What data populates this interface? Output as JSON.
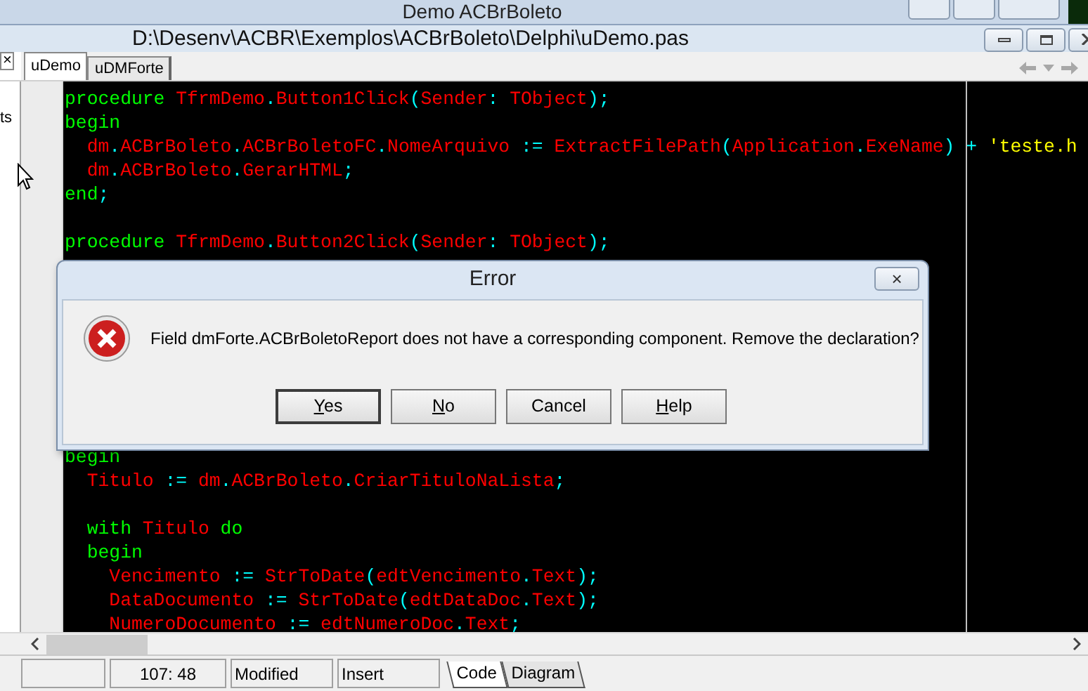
{
  "background_window": {
    "title": "Demo ACBrBoleto"
  },
  "window": {
    "title": "D:\\Desenv\\ACBR\\Exemplos\\ACBrBoleto\\Delphi\\uDemo.pas"
  },
  "side_panel": {
    "close": "×",
    "label": "ts"
  },
  "tabs": [
    {
      "label": "uDemo",
      "selected": true
    },
    {
      "label": "uDMForte",
      "selected": false
    }
  ],
  "code_top": [
    {
      "kind": "code",
      "tokens": [
        {
          "kind": "keyword",
          "text": "procedure "
        },
        {
          "kind": "ident",
          "text": "TfrmDemo"
        },
        {
          "kind": "symbol",
          "text": "."
        },
        {
          "kind": "ident",
          "text": "Button1Click"
        },
        {
          "kind": "symbol",
          "text": "("
        },
        {
          "kind": "ident",
          "text": "Sender"
        },
        {
          "kind": "symbol",
          "text": ": "
        },
        {
          "kind": "ident",
          "text": "TObject"
        },
        {
          "kind": "symbol",
          "text": ");"
        }
      ]
    },
    {
      "kind": "code",
      "tokens": [
        {
          "kind": "keyword",
          "text": "begin"
        }
      ]
    },
    {
      "kind": "code",
      "tokens": [
        {
          "kind": "ident",
          "text": "  dm"
        },
        {
          "kind": "symbol",
          "text": "."
        },
        {
          "kind": "ident",
          "text": "ACBrBoleto"
        },
        {
          "kind": "symbol",
          "text": "."
        },
        {
          "kind": "ident",
          "text": "ACBrBoletoFC"
        },
        {
          "kind": "symbol",
          "text": "."
        },
        {
          "kind": "ident",
          "text": "NomeArquivo"
        },
        {
          "kind": "symbol",
          "text": " := "
        },
        {
          "kind": "ident",
          "text": "ExtractFilePath"
        },
        {
          "kind": "symbol",
          "text": "("
        },
        {
          "kind": "ident",
          "text": "Application"
        },
        {
          "kind": "symbol",
          "text": "."
        },
        {
          "kind": "ident",
          "text": "ExeName"
        },
        {
          "kind": "symbol",
          "text": ") + "
        },
        {
          "kind": "string",
          "text": "'teste.h"
        }
      ]
    },
    {
      "kind": "code",
      "tokens": [
        {
          "kind": "ident",
          "text": "  dm"
        },
        {
          "kind": "symbol",
          "text": "."
        },
        {
          "kind": "ident",
          "text": "ACBrBoleto"
        },
        {
          "kind": "symbol",
          "text": "."
        },
        {
          "kind": "ident",
          "text": "GerarHTML"
        },
        {
          "kind": "symbol",
          "text": ";"
        }
      ]
    },
    {
      "kind": "code",
      "tokens": [
        {
          "kind": "keyword",
          "text": "end"
        },
        {
          "kind": "symbol",
          "text": ";"
        }
      ]
    },
    {
      "kind": "blank"
    },
    {
      "kind": "code",
      "tokens": [
        {
          "kind": "keyword",
          "text": "procedure "
        },
        {
          "kind": "ident",
          "text": "TfrmDemo"
        },
        {
          "kind": "symbol",
          "text": "."
        },
        {
          "kind": "ident",
          "text": "Button2Click"
        },
        {
          "kind": "symbol",
          "text": "("
        },
        {
          "kind": "ident",
          "text": "Sender"
        },
        {
          "kind": "symbol",
          "text": ": "
        },
        {
          "kind": "ident",
          "text": "TObject"
        },
        {
          "kind": "symbol",
          "text": ");"
        }
      ]
    }
  ],
  "code_bottom": [
    {
      "kind": "code",
      "tokens": [
        {
          "kind": "keyword",
          "text": "begin"
        }
      ]
    },
    {
      "kind": "code",
      "tokens": [
        {
          "kind": "ident",
          "text": "  Titulo"
        },
        {
          "kind": "symbol",
          "text": " := "
        },
        {
          "kind": "ident",
          "text": "dm"
        },
        {
          "kind": "symbol",
          "text": "."
        },
        {
          "kind": "ident",
          "text": "ACBrBoleto"
        },
        {
          "kind": "symbol",
          "text": "."
        },
        {
          "kind": "ident",
          "text": "CriarTituloNaLista"
        },
        {
          "kind": "symbol",
          "text": ";"
        }
      ]
    },
    {
      "kind": "blank"
    },
    {
      "kind": "code",
      "tokens": [
        {
          "kind": "keyword",
          "text": "  with "
        },
        {
          "kind": "ident",
          "text": "Titulo"
        },
        {
          "kind": "keyword",
          "text": " do"
        }
      ]
    },
    {
      "kind": "code",
      "tokens": [
        {
          "kind": "keyword",
          "text": "  begin"
        }
      ]
    },
    {
      "kind": "code",
      "tokens": [
        {
          "kind": "ident",
          "text": "    Vencimento"
        },
        {
          "kind": "symbol",
          "text": " := "
        },
        {
          "kind": "ident",
          "text": "StrToDate"
        },
        {
          "kind": "symbol",
          "text": "("
        },
        {
          "kind": "ident",
          "text": "edtVencimento"
        },
        {
          "kind": "symbol",
          "text": "."
        },
        {
          "kind": "ident",
          "text": "Text"
        },
        {
          "kind": "symbol",
          "text": ");"
        }
      ]
    },
    {
      "kind": "code",
      "tokens": [
        {
          "kind": "ident",
          "text": "    DataDocumento"
        },
        {
          "kind": "symbol",
          "text": " := "
        },
        {
          "kind": "ident",
          "text": "StrToDate"
        },
        {
          "kind": "symbol",
          "text": "("
        },
        {
          "kind": "ident",
          "text": "edtDataDoc"
        },
        {
          "kind": "symbol",
          "text": "."
        },
        {
          "kind": "ident",
          "text": "Text"
        },
        {
          "kind": "symbol",
          "text": ");"
        }
      ]
    },
    {
      "kind": "code",
      "tokens": [
        {
          "kind": "ident",
          "text": "    NumeroDocumento"
        },
        {
          "kind": "symbol",
          "text": " := "
        },
        {
          "kind": "ident",
          "text": "edtNumeroDoc"
        },
        {
          "kind": "symbol",
          "text": "."
        },
        {
          "kind": "ident",
          "text": "Text"
        },
        {
          "kind": "symbol",
          "text": ";"
        }
      ]
    }
  ],
  "dialog": {
    "title": "Error",
    "close": "×",
    "message": "Field dmForte.ACBrBoletoReport does not have a corresponding component. Remove the declaration?",
    "buttons": [
      {
        "label": "Yes",
        "mnemonic": true,
        "default": true
      },
      {
        "label": "No",
        "mnemonic": true,
        "default": false
      },
      {
        "label": "Cancel",
        "mnemonic": false,
        "default": false
      },
      {
        "label": "Help",
        "mnemonic": true,
        "default": false
      }
    ]
  },
  "status_bar": {
    "position": "107: 48",
    "modified": "Modified",
    "mode": "Insert",
    "view_tabs": [
      {
        "label": "Code",
        "selected": true
      },
      {
        "label": "Diagram",
        "selected": false
      }
    ]
  }
}
